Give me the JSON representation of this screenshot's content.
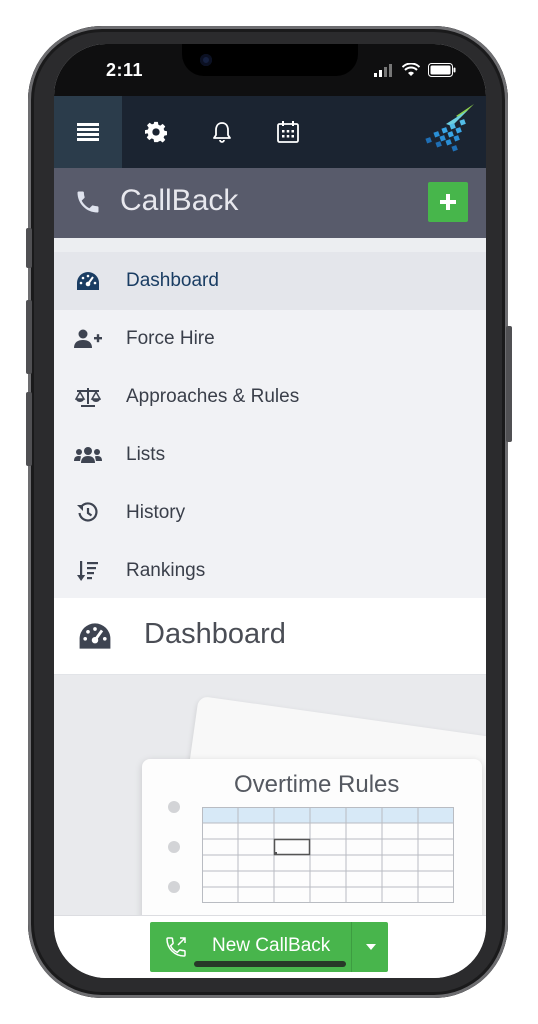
{
  "status_bar": {
    "time": "2:11"
  },
  "toolbar": {
    "icons": [
      "menu-icon",
      "gear-icon",
      "bell-icon",
      "calendar-icon",
      "logo-icon"
    ]
  },
  "section": {
    "title": "CallBack",
    "add_label": "+"
  },
  "menu": {
    "items": [
      {
        "label": "Dashboard",
        "icon": "gauge-icon",
        "active": true
      },
      {
        "label": "Force Hire",
        "icon": "user-plus-icon",
        "active": false
      },
      {
        "label": "Approaches & Rules",
        "icon": "balance-scale-icon",
        "active": false
      },
      {
        "label": "Lists",
        "icon": "users-icon",
        "active": false
      },
      {
        "label": "History",
        "icon": "history-icon",
        "active": false
      },
      {
        "label": "Rankings",
        "icon": "sort-icon",
        "active": false
      }
    ]
  },
  "dashboard": {
    "title": "Dashboard"
  },
  "illustration": {
    "title": "Overtime Rules"
  },
  "bottom": {
    "new_callback_label": "New CallBack"
  },
  "colors": {
    "toolbar_bg": "#1b2431",
    "header_bg": "#585b6b",
    "accent_green": "#48b54c",
    "active_text": "#1a3d63"
  }
}
